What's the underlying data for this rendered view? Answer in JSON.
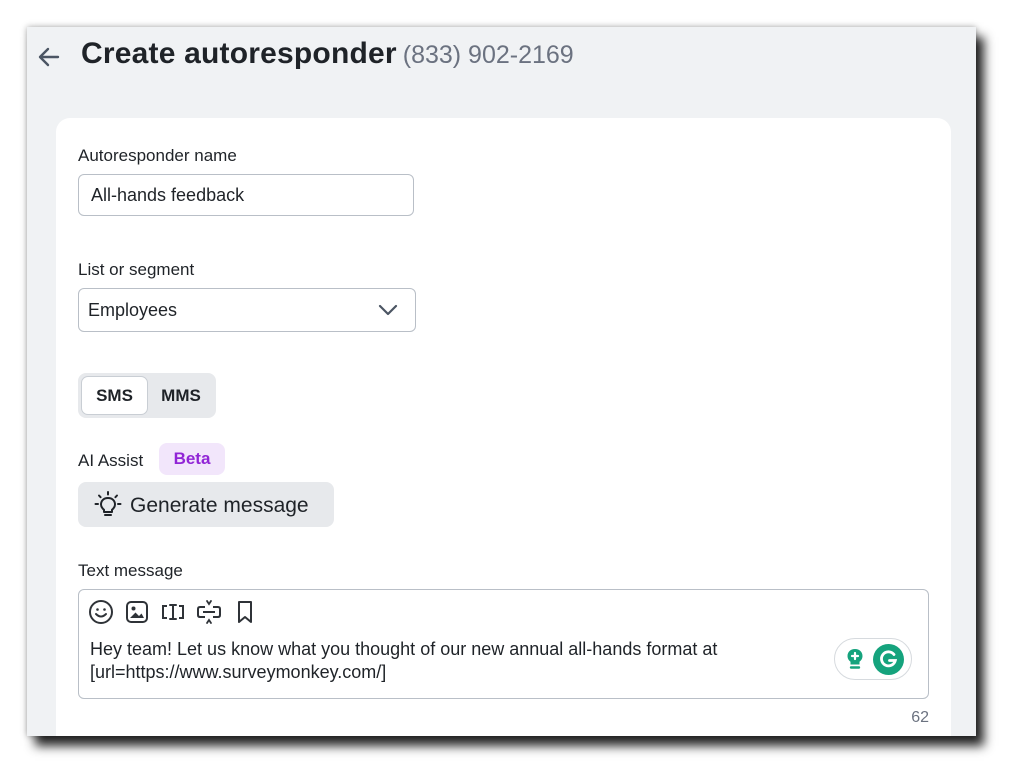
{
  "header": {
    "title": "Create autoresponder",
    "phone": "(833) 902-2169"
  },
  "form": {
    "name_label": "Autoresponder name",
    "name_value": "All-hands feedback",
    "list_label": "List or segment",
    "list_value": "Employees",
    "message_type": {
      "options": [
        "SMS",
        "MMS"
      ],
      "selected": "SMS"
    },
    "ai_assist_label": "AI Assist",
    "ai_badge": "Beta",
    "generate_label": "Generate message",
    "text_label": "Text message",
    "toolbar_icons": [
      "emoji-icon",
      "image-icon",
      "merge-field-icon",
      "link-shortener-icon",
      "bookmark-icon"
    ],
    "message_lines": [
      "Hey team! Let us know what you thought of our new annual all-hands format at",
      "[url=https://www.surveymonkey.com/]"
    ],
    "char_count": "62"
  },
  "colors": {
    "page_bg": "#f0f2f4",
    "card_bg": "#ffffff",
    "beta_bg": "#f2e6fb",
    "beta_text": "#9125d6",
    "grammarly_green": "#15a37d"
  }
}
